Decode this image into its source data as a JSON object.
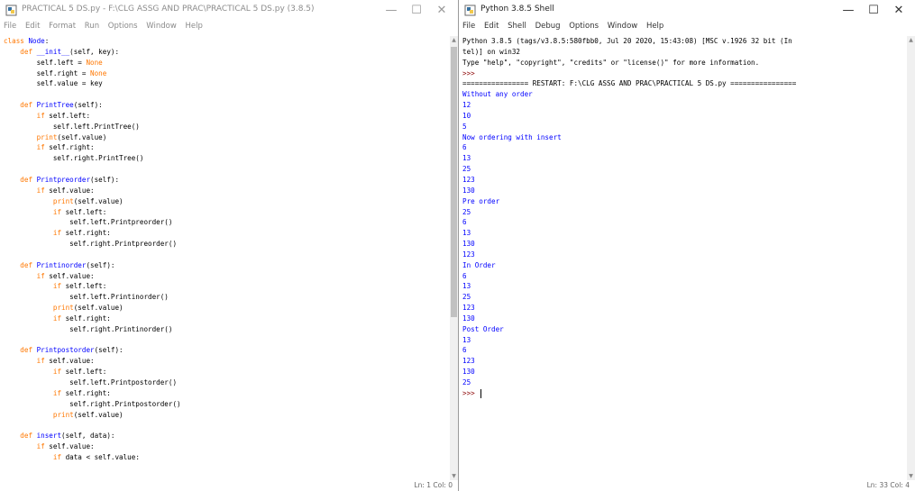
{
  "editor": {
    "title": "PRACTICAL 5 DS.py - F:\\CLG ASSG AND PRAC\\PRACTICAL 5 DS.py (3.8.5)",
    "menu": [
      "File",
      "Edit",
      "Format",
      "Run",
      "Options",
      "Window",
      "Help"
    ],
    "status": "Ln: 1  Col: 0",
    "lines": [
      [
        [
          "kw",
          "class "
        ],
        [
          "def",
          "Node"
        ],
        [
          "plain",
          ":"
        ]
      ],
      [
        [
          "plain",
          "    "
        ],
        [
          "kw",
          "def "
        ],
        [
          "def",
          "__init__"
        ],
        [
          "plain",
          "(self, key):"
        ]
      ],
      [
        [
          "plain",
          "        self.left = "
        ],
        [
          "kw",
          "None"
        ]
      ],
      [
        [
          "plain",
          "        self.right = "
        ],
        [
          "kw",
          "None"
        ]
      ],
      [
        [
          "plain",
          "        self.value = key"
        ]
      ],
      [],
      [
        [
          "plain",
          "    "
        ],
        [
          "kw",
          "def "
        ],
        [
          "def",
          "PrintTree"
        ],
        [
          "plain",
          "(self):"
        ]
      ],
      [
        [
          "plain",
          "        "
        ],
        [
          "kw",
          "if "
        ],
        [
          "plain",
          "self.left:"
        ]
      ],
      [
        [
          "plain",
          "            self.left.PrintTree()"
        ]
      ],
      [
        [
          "plain",
          "        "
        ],
        [
          "kw",
          "print"
        ],
        [
          "plain",
          "(self.value)"
        ]
      ],
      [
        [
          "plain",
          "        "
        ],
        [
          "kw",
          "if "
        ],
        [
          "plain",
          "self.right:"
        ]
      ],
      [
        [
          "plain",
          "            self.right.PrintTree()"
        ]
      ],
      [],
      [
        [
          "plain",
          "    "
        ],
        [
          "kw",
          "def "
        ],
        [
          "def",
          "Printpreorder"
        ],
        [
          "plain",
          "(self):"
        ]
      ],
      [
        [
          "plain",
          "        "
        ],
        [
          "kw",
          "if "
        ],
        [
          "plain",
          "self.value:"
        ]
      ],
      [
        [
          "plain",
          "            "
        ],
        [
          "kw",
          "print"
        ],
        [
          "plain",
          "(self.value)"
        ]
      ],
      [
        [
          "plain",
          "            "
        ],
        [
          "kw",
          "if "
        ],
        [
          "plain",
          "self.left:"
        ]
      ],
      [
        [
          "plain",
          "                self.left.Printpreorder()"
        ]
      ],
      [
        [
          "plain",
          "            "
        ],
        [
          "kw",
          "if "
        ],
        [
          "plain",
          "self.right:"
        ]
      ],
      [
        [
          "plain",
          "                self.right.Printpreorder()"
        ]
      ],
      [],
      [
        [
          "plain",
          "    "
        ],
        [
          "kw",
          "def "
        ],
        [
          "def",
          "Printinorder"
        ],
        [
          "plain",
          "(self):"
        ]
      ],
      [
        [
          "plain",
          "        "
        ],
        [
          "kw",
          "if "
        ],
        [
          "plain",
          "self.value:"
        ]
      ],
      [
        [
          "plain",
          "            "
        ],
        [
          "kw",
          "if "
        ],
        [
          "plain",
          "self.left:"
        ]
      ],
      [
        [
          "plain",
          "                self.left.Printinorder()"
        ]
      ],
      [
        [
          "plain",
          "            "
        ],
        [
          "kw",
          "print"
        ],
        [
          "plain",
          "(self.value)"
        ]
      ],
      [
        [
          "plain",
          "            "
        ],
        [
          "kw",
          "if "
        ],
        [
          "plain",
          "self.right:"
        ]
      ],
      [
        [
          "plain",
          "                self.right.Printinorder()"
        ]
      ],
      [],
      [
        [
          "plain",
          "    "
        ],
        [
          "kw",
          "def "
        ],
        [
          "def",
          "Printpostorder"
        ],
        [
          "plain",
          "(self):"
        ]
      ],
      [
        [
          "plain",
          "        "
        ],
        [
          "kw",
          "if "
        ],
        [
          "plain",
          "self.value:"
        ]
      ],
      [
        [
          "plain",
          "            "
        ],
        [
          "kw",
          "if "
        ],
        [
          "plain",
          "self.left:"
        ]
      ],
      [
        [
          "plain",
          "                self.left.Printpostorder()"
        ]
      ],
      [
        [
          "plain",
          "            "
        ],
        [
          "kw",
          "if "
        ],
        [
          "plain",
          "self.right:"
        ]
      ],
      [
        [
          "plain",
          "                self.right.Printpostorder()"
        ]
      ],
      [
        [
          "plain",
          "            "
        ],
        [
          "kw",
          "print"
        ],
        [
          "plain",
          "(self.value)"
        ]
      ],
      [],
      [
        [
          "plain",
          "    "
        ],
        [
          "kw",
          "def "
        ],
        [
          "def",
          "insert"
        ],
        [
          "plain",
          "(self, data):"
        ]
      ],
      [
        [
          "plain",
          "        "
        ],
        [
          "kw",
          "if "
        ],
        [
          "plain",
          "self.value:"
        ]
      ],
      [
        [
          "plain",
          "            "
        ],
        [
          "kw",
          "if "
        ],
        [
          "plain",
          "data < self.value:"
        ]
      ]
    ]
  },
  "shell": {
    "title": "Python 3.8.5 Shell",
    "menu": [
      "File",
      "Edit",
      "Shell",
      "Debug",
      "Options",
      "Window",
      "Help"
    ],
    "status": "Ln: 33  Col: 4",
    "lines": [
      [
        [
          "shellhdr",
          "Python 3.8.5 (tags/v3.8.5:580fbb0, Jul 20 2020, 15:43:08) [MSC v.1926 32 bit (In"
        ]
      ],
      [
        [
          "shellhdr",
          "tel)] on win32"
        ]
      ],
      [
        [
          "shellhdr",
          "Type \"help\", \"copyright\", \"credits\" or \"license()\" for more information."
        ]
      ],
      [
        [
          "prompt",
          ">>> "
        ]
      ],
      [
        [
          "shellhdr",
          "================ RESTART: F:\\CLG ASSG AND PRAC\\PRACTICAL 5 DS.py ================"
        ]
      ],
      [
        [
          "out",
          "Without any order"
        ]
      ],
      [
        [
          "out",
          "12"
        ]
      ],
      [
        [
          "out",
          "10"
        ]
      ],
      [
        [
          "out",
          "5"
        ]
      ],
      [
        [
          "out",
          "Now ordering with insert"
        ]
      ],
      [
        [
          "out",
          "6"
        ]
      ],
      [
        [
          "out",
          "13"
        ]
      ],
      [
        [
          "out",
          "25"
        ]
      ],
      [
        [
          "out",
          "123"
        ]
      ],
      [
        [
          "out",
          "130"
        ]
      ],
      [
        [
          "out",
          "Pre order"
        ]
      ],
      [
        [
          "out",
          "25"
        ]
      ],
      [
        [
          "out",
          "6"
        ]
      ],
      [
        [
          "out",
          "13"
        ]
      ],
      [
        [
          "out",
          "130"
        ]
      ],
      [
        [
          "out",
          "123"
        ]
      ],
      [
        [
          "out",
          "In Order"
        ]
      ],
      [
        [
          "out",
          "6"
        ]
      ],
      [
        [
          "out",
          "13"
        ]
      ],
      [
        [
          "out",
          "25"
        ]
      ],
      [
        [
          "out",
          "123"
        ]
      ],
      [
        [
          "out",
          "130"
        ]
      ],
      [
        [
          "out",
          "Post Order"
        ]
      ],
      [
        [
          "out",
          "13"
        ]
      ],
      [
        [
          "out",
          "6"
        ]
      ],
      [
        [
          "out",
          "123"
        ]
      ],
      [
        [
          "out",
          "130"
        ]
      ],
      [
        [
          "out",
          "25"
        ]
      ],
      [
        [
          "prompt",
          ">>> "
        ]
      ]
    ]
  },
  "window_controls": [
    "—",
    "☐",
    "✕"
  ],
  "colors": {
    "keyword": "#ff7700",
    "definition": "#0000ff",
    "output": "#0000ff",
    "prompt": "#8b0000",
    "builtin": "#900090"
  }
}
